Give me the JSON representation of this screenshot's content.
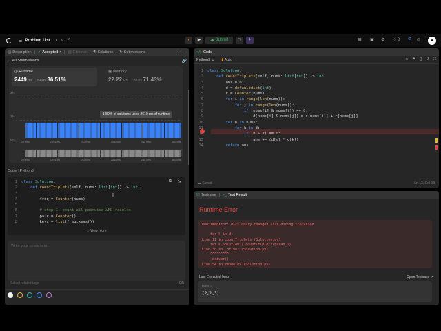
{
  "topbar": {
    "title": "Problem List",
    "submit": "Submit",
    "notif_count": "0"
  },
  "left": {
    "tabs": [
      "Description",
      "Accepted",
      "Editorial",
      "Solutions",
      "Submissions"
    ],
    "back": "All Submissions",
    "runtime": {
      "label": "Runtime",
      "value": "2449",
      "unit": "ms",
      "beats_label": "Beats",
      "beats": "36.51%"
    },
    "memory": {
      "label": "Memory",
      "value": "22.22",
      "unit": "MB",
      "beats_label": "Beats",
      "beats": "71.43%"
    },
    "tooltip": "1.59% of solutions used 2610 ms of runtime",
    "yticks": [
      "2%",
      "1%",
      "0%"
    ],
    "xticks": [
      "279ms",
      "1201ms",
      "1925ms",
      "2518ms",
      "2487ms",
      "3603ms"
    ],
    "code_header": {
      "title": "Code",
      "lang": "Python3"
    },
    "code": [
      [
        "1",
        "class Solution:"
      ],
      [
        "2",
        "    def countTriplets(self, nums: List[int]) -> int:"
      ],
      [
        "3",
        ""
      ],
      [
        "4",
        "        freq = Counter(nums)"
      ],
      [
        "5",
        ""
      ],
      [
        "6",
        "        # step 1: count all pairwise AND results"
      ],
      [
        "7",
        "        pair = Counter()"
      ],
      [
        "8",
        "        keys = list(freq.keys())"
      ]
    ],
    "view_more": "View more",
    "notes_placeholder": "Write your notes here",
    "tags_placeholder": "Select related tags",
    "tags_count": "0/5",
    "color_dots": [
      "#f0f0f0",
      "#e8b830",
      "#2fb4b4",
      "#3b82f6",
      "#c07bd6"
    ]
  },
  "editor": {
    "title": "Code",
    "lang": "Python3",
    "auto": "Auto",
    "lines": [
      [
        "1",
        "class Solution:"
      ],
      [
        "2",
        "    def countTriplets(self, nums: List[int]) -> int:"
      ],
      [
        "3",
        "        ans = 0"
      ],
      [
        "4",
        "        d = defaultdict(int)"
      ],
      [
        "5",
        "        c = Counter(nums)"
      ],
      [
        "6",
        "        for i in range(len(nums)):"
      ],
      [
        "7",
        "            for j in range(len(nums)):"
      ],
      [
        "8",
        "                if (nums[i] & nums[j]) == 0:"
      ],
      [
        "9",
        "                    d[nums[i] & nums[j]] = c[nums[i]] + c[nums[j]]"
      ],
      [
        "10",
        "        for n in nums:"
      ],
      [
        "11",
        "            for k in d:"
      ],
      [
        "12",
        "                if (n & k) == 0:"
      ],
      [
        "13",
        "                    ans += (d[n] * c[k])"
      ],
      [
        "14",
        "        return ans"
      ]
    ],
    "saved": "Saved",
    "position": "Ln 13, Col 38"
  },
  "result": {
    "tabs": [
      "Testcase",
      "Test Result"
    ],
    "title": "Runtime Error",
    "trace": [
      "RuntimeError: dictionary changed size during iteration",
      "          ^",
      "    for k in d:",
      "Line 11 in countTriplets (Solution.py)",
      "    ret = Solution().countTriplets(param_1)",
      "Line 30 in _driver (Solution.py)",
      "    ^^^^^^^^^",
      "    _driver()",
      "Line 54 in <module> (Solution.py)"
    ],
    "last_input": "Last Executed Input",
    "open_testcase": "Open Testcase",
    "var": "nums =",
    "value": "[2,1,3]"
  }
}
